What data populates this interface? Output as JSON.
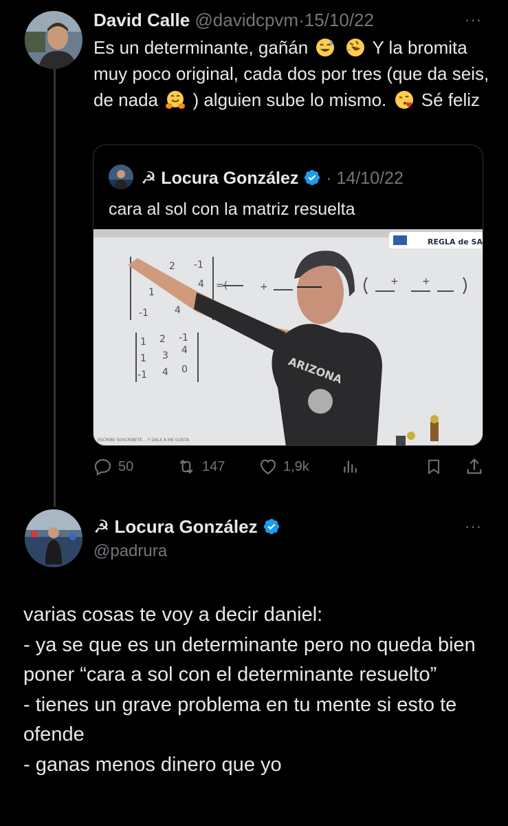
{
  "tweet1": {
    "author_name": "David Calle",
    "handle": "@davidcpvm",
    "separator": "·",
    "date": "15/10/22",
    "text_parts": [
      "Es un determinante, gañán",
      "Y la bromita muy poco original, cada dos por tres (que da seis, de nada",
      ") alguien sube lo mismo.",
      "Sé feliz"
    ],
    "emojis": [
      "sweat-smile",
      "rofl",
      "hugging",
      "kissing-heart"
    ],
    "quote": {
      "author_name": "☭ Locura González",
      "date": "· 14/10/22",
      "text": "cara al sol con la matriz resuelta",
      "media_caption": "REGLA de SA",
      "board_bottom_text": "ESCRIBE SUSCRÍBETE... Y DALE A ME GUSTA"
    },
    "actions": {
      "replies": "50",
      "retweets": "147",
      "likes": "1,9k"
    }
  },
  "tweet2": {
    "author_name": "☭ Locura González",
    "handle": "@padrura",
    "text": "varias cosas te voy a decir daniel:\n- ya se que es un determinante pero no queda bien poner “cara a sol con el determinante resuelto”\n- tienes un grave problema en tu mente si esto te ofende\n- ganas menos dinero que yo"
  },
  "more_label": "···",
  "colors": {
    "background": "#000000",
    "text": "#e7e9ea",
    "muted": "#71767b",
    "verified": "#1d9bf0",
    "border": "#2f3336"
  }
}
